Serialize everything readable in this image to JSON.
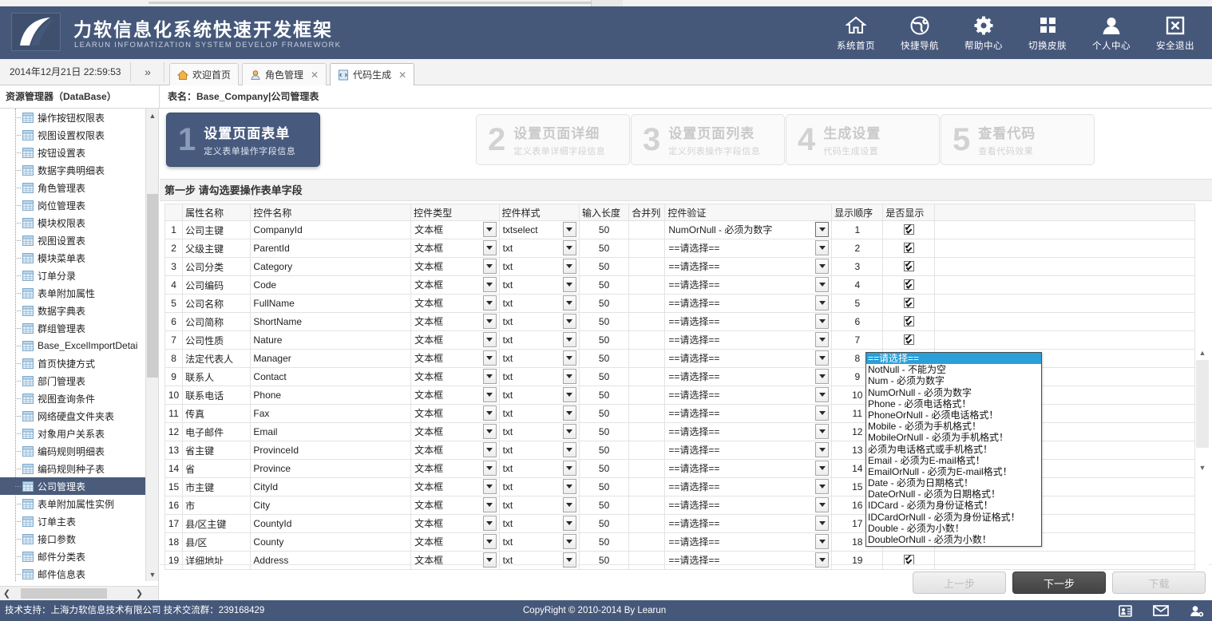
{
  "brand": {
    "title_cn": "力软信息化系统快速开发框架",
    "title_en": "LEARUN  INFOMATIZATION  SYSTEM  DEVELOP  FRAMEWORK",
    "logo_icon": "leaf-logo-icon",
    "header_bg": "#46587a"
  },
  "header_actions": [
    {
      "label": "系统首页",
      "icon": "home-icon"
    },
    {
      "label": "快捷导航",
      "icon": "globe-icon"
    },
    {
      "label": "帮助中心",
      "icon": "gear-icon"
    },
    {
      "label": "切换皮肤",
      "icon": "grid-squares-icon"
    },
    {
      "label": "个人中心",
      "icon": "user-icon"
    },
    {
      "label": "安全退出",
      "icon": "close-box-icon"
    }
  ],
  "tabbar": {
    "clock": "2014年12月21日 22:59:53",
    "expander_icon": "chevron-double-right-icon",
    "tabs": [
      {
        "label": "欢迎首页",
        "icon": "home-small-icon",
        "closable": false,
        "active": false
      },
      {
        "label": "角色管理",
        "icon": "user-small-icon",
        "closable": true,
        "active": false
      },
      {
        "label": "代码生成",
        "icon": "code-small-icon",
        "closable": true,
        "active": true
      }
    ]
  },
  "subbar": {
    "resource_title": "资源管理器（DataBase）",
    "table_title": "表名：Base_Company|公司管理表"
  },
  "tree": {
    "items": [
      {
        "label": "操作按钮权限表",
        "selected": false
      },
      {
        "label": "视图设置权限表",
        "selected": false
      },
      {
        "label": "按钮设置表",
        "selected": false
      },
      {
        "label": "数据字典明细表",
        "selected": false
      },
      {
        "label": "角色管理表",
        "selected": false
      },
      {
        "label": "岗位管理表",
        "selected": false
      },
      {
        "label": "模块权限表",
        "selected": false
      },
      {
        "label": "视图设置表",
        "selected": false
      },
      {
        "label": "模块菜单表",
        "selected": false
      },
      {
        "label": "订单分录",
        "selected": false
      },
      {
        "label": "表单附加属性",
        "selected": false
      },
      {
        "label": "数据字典表",
        "selected": false
      },
      {
        "label": "群组管理表",
        "selected": false
      },
      {
        "label": "Base_ExcelImportDetai",
        "selected": false
      },
      {
        "label": "首页快捷方式",
        "selected": false
      },
      {
        "label": "部门管理表",
        "selected": false
      },
      {
        "label": "视图查询条件",
        "selected": false
      },
      {
        "label": "网络硬盘文件夹表",
        "selected": false
      },
      {
        "label": "对象用户关系表",
        "selected": false
      },
      {
        "label": "编码规则明细表",
        "selected": false
      },
      {
        "label": "编码规则种子表",
        "selected": false
      },
      {
        "label": "公司管理表",
        "selected": true
      },
      {
        "label": "表单附加属性实例",
        "selected": false
      },
      {
        "label": "订单主表",
        "selected": false
      },
      {
        "label": "接口参数",
        "selected": false
      },
      {
        "label": "邮件分类表",
        "selected": false
      },
      {
        "label": "邮件信息表",
        "selected": false
      }
    ]
  },
  "wizard": {
    "steps": [
      {
        "num": "1",
        "title": "设置页面表单",
        "desc": "定义表单操作字段信息",
        "active": true
      },
      {
        "num": "2",
        "title": "设置页面详细",
        "desc": "定义表单详细字段信息",
        "active": false
      },
      {
        "num": "3",
        "title": "设置页面列表",
        "desc": "定义列表操作字段信息",
        "active": false
      },
      {
        "num": "4",
        "title": "生成设置",
        "desc": "代码生成设置",
        "active": false
      },
      {
        "num": "5",
        "title": "查看代码",
        "desc": "查看代码效果",
        "active": false
      }
    ]
  },
  "section": {
    "title": "第一步 请勾选要操作表单字段"
  },
  "grid": {
    "columns": [
      "",
      "属性名称",
      "控件名称",
      "控件类型",
      "控件样式",
      "输入长度",
      "合并列",
      "控件验证",
      "显示顺序",
      "是否显示"
    ],
    "rows": [
      {
        "idx": "1",
        "attr": "公司主键",
        "ctl_name": "CompanyId",
        "ctl_type": "文本框",
        "ctl_style": "txtselect",
        "length": "50",
        "merge": "",
        "validate": "NumOrNull - 必须为数字",
        "order": "1",
        "show": true,
        "validate_open": true
      },
      {
        "idx": "2",
        "attr": "父级主键",
        "ctl_name": "ParentId",
        "ctl_type": "文本框",
        "ctl_style": "txt",
        "length": "50",
        "merge": "",
        "validate": "==请选择==",
        "order": "2",
        "show": true
      },
      {
        "idx": "3",
        "attr": "公司分类",
        "ctl_name": "Category",
        "ctl_type": "文本框",
        "ctl_style": "txt",
        "length": "50",
        "merge": "",
        "validate": "==请选择==",
        "order": "3",
        "show": true
      },
      {
        "idx": "4",
        "attr": "公司编码",
        "ctl_name": "Code",
        "ctl_type": "文本框",
        "ctl_style": "txt",
        "length": "50",
        "merge": "",
        "validate": "==请选择==",
        "order": "4",
        "show": true
      },
      {
        "idx": "5",
        "attr": "公司名称",
        "ctl_name": "FullName",
        "ctl_type": "文本框",
        "ctl_style": "txt",
        "length": "50",
        "merge": "",
        "validate": "==请选择==",
        "order": "5",
        "show": true
      },
      {
        "idx": "6",
        "attr": "公司简称",
        "ctl_name": "ShortName",
        "ctl_type": "文本框",
        "ctl_style": "txt",
        "length": "50",
        "merge": "",
        "validate": "==请选择==",
        "order": "6",
        "show": true
      },
      {
        "idx": "7",
        "attr": "公司性质",
        "ctl_name": "Nature",
        "ctl_type": "文本框",
        "ctl_style": "txt",
        "length": "50",
        "merge": "",
        "validate": "==请选择==",
        "order": "7",
        "show": true
      },
      {
        "idx": "8",
        "attr": "法定代表人",
        "ctl_name": "Manager",
        "ctl_type": "文本框",
        "ctl_style": "txt",
        "length": "50",
        "merge": "",
        "validate": "==请选择==",
        "order": "8",
        "show": true
      },
      {
        "idx": "9",
        "attr": "联系人",
        "ctl_name": "Contact",
        "ctl_type": "文本框",
        "ctl_style": "txt",
        "length": "50",
        "merge": "",
        "validate": "==请选择==",
        "order": "9",
        "show": true
      },
      {
        "idx": "10",
        "attr": "联系电话",
        "ctl_name": "Phone",
        "ctl_type": "文本框",
        "ctl_style": "txt",
        "length": "50",
        "merge": "",
        "validate": "==请选择==",
        "order": "10",
        "show": true
      },
      {
        "idx": "11",
        "attr": "传真",
        "ctl_name": "Fax",
        "ctl_type": "文本框",
        "ctl_style": "txt",
        "length": "50",
        "merge": "",
        "validate": "==请选择==",
        "order": "11",
        "show": true
      },
      {
        "idx": "12",
        "attr": "电子邮件",
        "ctl_name": "Email",
        "ctl_type": "文本框",
        "ctl_style": "txt",
        "length": "50",
        "merge": "",
        "validate": "==请选择==",
        "order": "12",
        "show": true
      },
      {
        "idx": "13",
        "attr": "省主键",
        "ctl_name": "ProvinceId",
        "ctl_type": "文本框",
        "ctl_style": "txt",
        "length": "50",
        "merge": "",
        "validate": "==请选择==",
        "order": "13",
        "show": true
      },
      {
        "idx": "14",
        "attr": "省",
        "ctl_name": "Province",
        "ctl_type": "文本框",
        "ctl_style": "txt",
        "length": "50",
        "merge": "",
        "validate": "==请选择==",
        "order": "14",
        "show": true
      },
      {
        "idx": "15",
        "attr": "市主键",
        "ctl_name": "CityId",
        "ctl_type": "文本框",
        "ctl_style": "txt",
        "length": "50",
        "merge": "",
        "validate": "==请选择==",
        "order": "15",
        "show": true
      },
      {
        "idx": "16",
        "attr": "市",
        "ctl_name": "City",
        "ctl_type": "文本框",
        "ctl_style": "txt",
        "length": "50",
        "merge": "",
        "validate": "==请选择==",
        "order": "16",
        "show": true
      },
      {
        "idx": "17",
        "attr": "县/区主键",
        "ctl_name": "CountyId",
        "ctl_type": "文本框",
        "ctl_style": "txt",
        "length": "50",
        "merge": "",
        "validate": "==请选择==",
        "order": "17",
        "show": true
      },
      {
        "idx": "18",
        "attr": "县/区",
        "ctl_name": "County",
        "ctl_type": "文本框",
        "ctl_style": "txt",
        "length": "50",
        "merge": "",
        "validate": "==请选择==",
        "order": "18",
        "show": true
      },
      {
        "idx": "19",
        "attr": "详细地址",
        "ctl_name": "Address",
        "ctl_type": "文本框",
        "ctl_style": "txt",
        "length": "50",
        "merge": "",
        "validate": "==请选择==",
        "order": "19",
        "show": true
      }
    ]
  },
  "validate_dropdown": {
    "open": true,
    "selected_index": 0,
    "highlight_color": "#2a9fd8",
    "options": [
      "==请选择==",
      "NotNull - 不能为空",
      "Num - 必须为数字",
      "NumOrNull - 必须为数字",
      "Phone - 必须电话格式！",
      "PhoneOrNull - 必须电话格式！",
      "Mobile - 必须为手机格式！",
      "MobileOrNull - 必须为手机格式！",
      "必须为电话格式或手机格式！",
      "Email - 必须为E-mail格式！",
      "EmailOrNull - 必须为E-mail格式！",
      "Date - 必须为日期格式！",
      "DateOrNull - 必须为日期格式！",
      "IDCard - 必须为身份证格式！",
      "IDCardOrNull - 必须为身份证格式！",
      "Double - 必须为小数！",
      "DoubleOrNull - 必须为小数！"
    ]
  },
  "footer_buttons": [
    {
      "label": "上一步",
      "state": "disabled"
    },
    {
      "label": "下一步",
      "state": "primary"
    },
    {
      "label": "下载",
      "state": "disabled"
    }
  ],
  "footer": {
    "left": "技术支持：上海力软信息技术有限公司   技术交流群：239168429",
    "center": "CopyRight © 2010-2014 By Learun",
    "icons": [
      "contact-card-icon",
      "mail-icon",
      "user-add-icon"
    ]
  }
}
